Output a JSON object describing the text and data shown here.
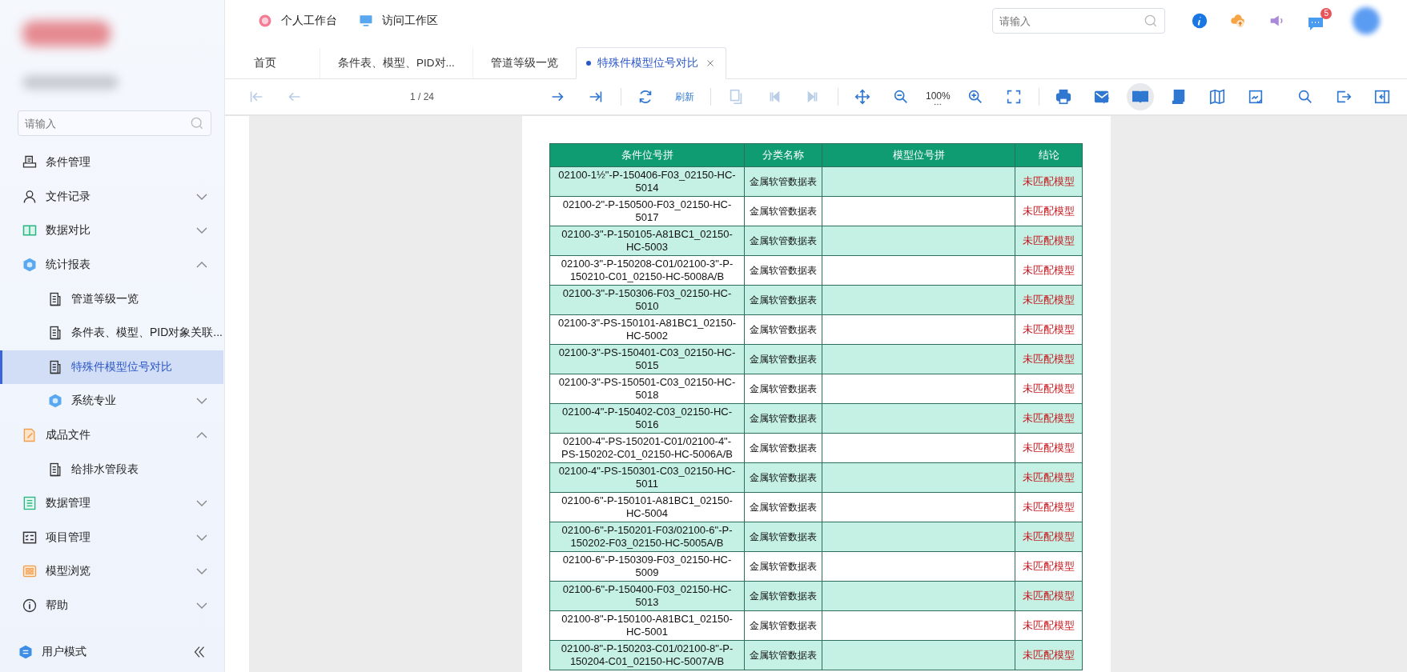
{
  "header": {
    "links": [
      {
        "label": "个人工作台"
      },
      {
        "label": "访问工作区"
      }
    ],
    "search": {
      "placeholder": "请输入"
    },
    "messages": {
      "badge": "5"
    }
  },
  "sidebar": {
    "search": {
      "placeholder": "请输入"
    },
    "items": [
      {
        "label": "条件管理",
        "kind": "link",
        "selected": false
      },
      {
        "label": "文件记录",
        "kind": "group",
        "expanded": false,
        "selected": false
      },
      {
        "label": "数据对比",
        "kind": "group",
        "expanded": false,
        "selected": false
      },
      {
        "label": "统计报表",
        "kind": "group",
        "expanded": true,
        "selected": false,
        "children": [
          {
            "label": "管道等级一览",
            "kind": "link",
            "selected": false
          },
          {
            "label": "条件表、模型、PID对象关联...",
            "kind": "link",
            "selected": false
          },
          {
            "label": "特殊件模型位号对比",
            "kind": "link",
            "selected": true
          },
          {
            "label": "系统专业",
            "kind": "group",
            "expanded": false,
            "selected": false
          }
        ]
      },
      {
        "label": "成品文件",
        "kind": "group",
        "expanded": true,
        "selected": false,
        "children": [
          {
            "label": "给排水管段表",
            "kind": "link",
            "selected": false
          }
        ]
      },
      {
        "label": "数据管理",
        "kind": "group",
        "expanded": false,
        "selected": false
      },
      {
        "label": "项目管理",
        "kind": "group",
        "expanded": false,
        "selected": false
      },
      {
        "label": "模型浏览",
        "kind": "group",
        "expanded": false,
        "selected": false
      },
      {
        "label": "帮助",
        "kind": "group",
        "expanded": false,
        "selected": false
      }
    ],
    "footer": {
      "label": "用户模式"
    }
  },
  "tabs": [
    {
      "label": "首页",
      "selected": false
    },
    {
      "label": "条件表、模型、PID对...",
      "selected": false
    },
    {
      "label": "管道等级一览",
      "selected": false
    },
    {
      "label": "特殊件模型位号对比",
      "selected": true
    }
  ],
  "toolbar": {
    "groups": [
      [
        {
          "kind": "icon",
          "disabled": true,
          "selected": false
        },
        {
          "kind": "icon",
          "disabled": true,
          "selected": false
        },
        {
          "kind": "text",
          "label": "1 / 24",
          "disabled": false,
          "selected": false
        },
        {
          "kind": "icon",
          "disabled": false,
          "selected": false
        },
        {
          "kind": "icon",
          "disabled": false,
          "selected": false
        }
      ],
      [
        {
          "kind": "icon",
          "disabled": false,
          "selected": false
        },
        {
          "kind": "text",
          "label": "刷新",
          "disabled": false,
          "selected": false
        }
      ],
      [
        {
          "kind": "icon",
          "disabled": true,
          "selected": false
        },
        {
          "kind": "icon",
          "disabled": true,
          "selected": false
        },
        {
          "kind": "icon",
          "disabled": true,
          "selected": false
        }
      ],
      [
        {
          "kind": "icon",
          "disabled": false,
          "selected": false
        },
        {
          "kind": "icon",
          "disabled": false,
          "selected": false
        },
        {
          "kind": "zoom",
          "label": "100%",
          "disabled": false,
          "selected": false
        },
        {
          "kind": "icon",
          "disabled": false,
          "selected": false
        },
        {
          "kind": "icon",
          "disabled": false,
          "selected": false
        }
      ],
      [
        {
          "kind": "icon",
          "disabled": false,
          "selected": false
        },
        {
          "kind": "icon",
          "disabled": false,
          "selected": false
        },
        {
          "kind": "icon",
          "disabled": false,
          "selected": true
        },
        {
          "kind": "icon",
          "disabled": false,
          "selected": false
        },
        {
          "kind": "icon",
          "disabled": false,
          "selected": false
        },
        {
          "kind": "icon",
          "disabled": false,
          "selected": false
        }
      ]
    ],
    "right": [
      {
        "kind": "icon",
        "disabled": false,
        "selected": false
      },
      {
        "kind": "icon",
        "disabled": false,
        "selected": false
      },
      {
        "kind": "icon",
        "disabled": false,
        "selected": false
      }
    ]
  },
  "table": {
    "columns": [
      "条件位号拼",
      "分类名称",
      "模型位号拼",
      "结论"
    ],
    "rows": [
      [
        "02100-1½\"-P-150406-F03_02150-HC-5014",
        "金属软管数据表",
        "",
        "未匹配模型"
      ],
      [
        "02100-2\"-P-150500-F03_02150-HC-5017",
        "金属软管数据表",
        "",
        "未匹配模型"
      ],
      [
        "02100-3\"-P-150105-A81BC1_02150-HC-5003",
        "金属软管数据表",
        "",
        "未匹配模型"
      ],
      [
        "02100-3\"-P-150208-C01/02100-3\"-P-150210-C01_02150-HC-5008A/B",
        "金属软管数据表",
        "",
        "未匹配模型"
      ],
      [
        "02100-3\"-P-150306-F03_02150-HC-5010",
        "金属软管数据表",
        "",
        "未匹配模型"
      ],
      [
        "02100-3\"-PS-150101-A81BC1_02150-HC-5002",
        "金属软管数据表",
        "",
        "未匹配模型"
      ],
      [
        "02100-3\"-PS-150401-C03_02150-HC-5015",
        "金属软管数据表",
        "",
        "未匹配模型"
      ],
      [
        "02100-3\"-PS-150501-C03_02150-HC-5018",
        "金属软管数据表",
        "",
        "未匹配模型"
      ],
      [
        "02100-4\"-P-150402-C03_02150-HC-5016",
        "金属软管数据表",
        "",
        "未匹配模型"
      ],
      [
        "02100-4\"-PS-150201-C01/02100-4\"-PS-150202-C01_02150-HC-5006A/B",
        "金属软管数据表",
        "",
        "未匹配模型"
      ],
      [
        "02100-4\"-PS-150301-C03_02150-HC-5011",
        "金属软管数据表",
        "",
        "未匹配模型"
      ],
      [
        "02100-6\"-P-150101-A81BC1_02150-HC-5004",
        "金属软管数据表",
        "",
        "未匹配模型"
      ],
      [
        "02100-6\"-P-150201-F03/02100-6\"-P-150202-F03_02150-HC-5005A/B",
        "金属软管数据表",
        "",
        "未匹配模型"
      ],
      [
        "02100-6\"-P-150309-F03_02150-HC-5009",
        "金属软管数据表",
        "",
        "未匹配模型"
      ],
      [
        "02100-6\"-P-150400-F03_02150-HC-5013",
        "金属软管数据表",
        "",
        "未匹配模型"
      ],
      [
        "02100-8\"-P-150100-A81BC1_02150-HC-5001",
        "金属软管数据表",
        "",
        "未匹配模型"
      ],
      [
        "02100-8\"-P-150203-C01/02100-8\"-P-150204-C01_02150-HC-5007A/B",
        "金属软管数据表",
        "",
        "未匹配模型"
      ]
    ]
  }
}
